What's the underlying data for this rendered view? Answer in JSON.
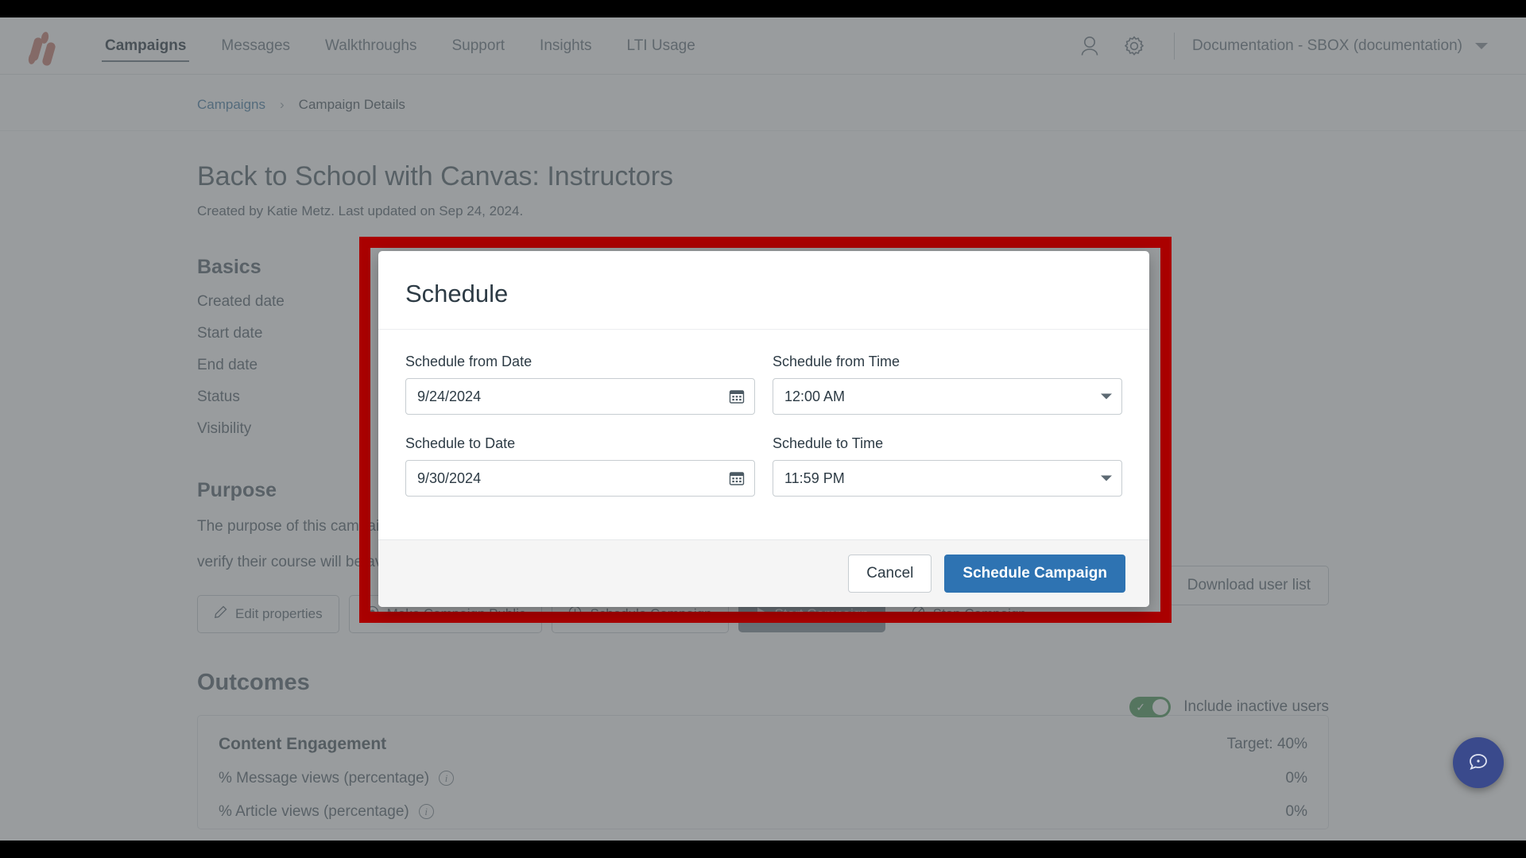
{
  "topnav": {
    "logo": "instructure-logo",
    "links": [
      {
        "label": "Campaigns",
        "active": true
      },
      {
        "label": "Messages",
        "active": false
      },
      {
        "label": "Walkthroughs",
        "active": false
      },
      {
        "label": "Support",
        "active": false
      },
      {
        "label": "Insights",
        "active": false
      },
      {
        "label": "LTI Usage",
        "active": false
      }
    ],
    "account_icon": "person-icon",
    "settings_icon": "gear-icon",
    "org_label": "Documentation - SBOX (documentation)"
  },
  "breadcrumb": {
    "root": "Campaigns",
    "separator": "›",
    "current": "Campaign Details"
  },
  "page": {
    "title": "Back to School with Canvas: Instructors",
    "subtitle": "Created by Katie Metz. Last updated on Sep 24, 2024.",
    "basics_heading": "Basics",
    "basics_rows": [
      {
        "label": "Created date"
      },
      {
        "label": "Start date"
      },
      {
        "label": "End date"
      },
      {
        "label": "Status"
      },
      {
        "label": "Visibility"
      }
    ],
    "purpose_heading": "Purpose",
    "purpose_text_line1": "The purpose of this campaign is to make sure instructors are ready for the new term and to",
    "purpose_text_line2": "verify their course will be available for students.",
    "download_button": "Download user list",
    "actions": [
      {
        "label": "Edit properties",
        "icon": "pencil-icon",
        "style": "outline"
      },
      {
        "label": "Make Campaign Public",
        "icon": "eye-icon",
        "style": "outline"
      },
      {
        "label": "Schedule Campaign",
        "icon": "clock-icon",
        "style": "outline"
      },
      {
        "label": "Start Campaign",
        "icon": "play-icon",
        "style": "filled"
      },
      {
        "label": "Stop Campaign",
        "icon": "ban-icon",
        "style": "ghost"
      }
    ],
    "outcomes_heading": "Outcomes",
    "outcomes_panel": {
      "title": "Content Engagement",
      "target": "Target: 40%",
      "metrics": [
        {
          "label": "% Message views (percentage)",
          "info": "info-icon",
          "value": "0%"
        },
        {
          "label": "% Article views (percentage)",
          "info": "info-icon",
          "value": "0%"
        }
      ]
    },
    "inactive_toggle": {
      "label": "Include inactive users",
      "state": "on"
    },
    "chat_fab": "chat-bubble-icon"
  },
  "modal": {
    "title": "Schedule",
    "fields": {
      "from_date": {
        "label": "Schedule from Date",
        "value": "9/24/2024",
        "icon": "calendar-icon"
      },
      "from_time": {
        "label": "Schedule from Time",
        "value": "12:00 AM",
        "icon": "chevron-down-icon"
      },
      "to_date": {
        "label": "Schedule to Date",
        "value": "9/30/2024",
        "icon": "calendar-icon"
      },
      "to_time": {
        "label": "Schedule to Time",
        "value": "11:59 PM",
        "icon": "chevron-down-icon"
      }
    },
    "cancel_label": "Cancel",
    "submit_label": "Schedule Campaign"
  },
  "colors": {
    "highlight_border": "#aa0000",
    "primary_button": "#2e73b2",
    "brand": "#c87b6e",
    "toggle_on": "#4c9a5a"
  }
}
